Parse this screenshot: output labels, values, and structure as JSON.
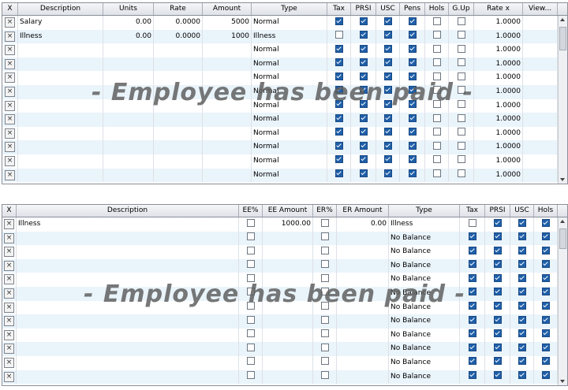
{
  "grid1": {
    "columns": [
      "X",
      "Description",
      "Units",
      "Rate",
      "Amount",
      "Type",
      "Tax",
      "PRSI",
      "USC",
      "Pens",
      "Hols",
      "G.Up",
      "Rate x",
      "View..."
    ],
    "watermark": "- Employee has been paid -",
    "rows": [
      {
        "desc": "Salary",
        "units": "0.00",
        "rate": "0.0000",
        "amount": "5000",
        "type": "Normal",
        "tax": true,
        "prsi": true,
        "usc": true,
        "pens": true,
        "hols": false,
        "gup": false,
        "ratex": "1.0000"
      },
      {
        "desc": "Illness",
        "units": "0.00",
        "rate": "0.0000",
        "amount": "1000",
        "type": "Illness",
        "tax": false,
        "prsi": true,
        "usc": true,
        "pens": true,
        "hols": false,
        "gup": false,
        "ratex": "1.0000"
      },
      {
        "desc": "",
        "units": "",
        "rate": "",
        "amount": "",
        "type": "Normal",
        "tax": true,
        "prsi": true,
        "usc": true,
        "pens": true,
        "hols": false,
        "gup": false,
        "ratex": "1.0000"
      },
      {
        "desc": "",
        "units": "",
        "rate": "",
        "amount": "",
        "type": "Normal",
        "tax": true,
        "prsi": true,
        "usc": true,
        "pens": true,
        "hols": false,
        "gup": false,
        "ratex": "1.0000"
      },
      {
        "desc": "",
        "units": "",
        "rate": "",
        "amount": "",
        "type": "Normal",
        "tax": true,
        "prsi": true,
        "usc": true,
        "pens": true,
        "hols": false,
        "gup": false,
        "ratex": "1.0000"
      },
      {
        "desc": "",
        "units": "",
        "rate": "",
        "amount": "",
        "type": "Normal",
        "tax": true,
        "prsi": true,
        "usc": true,
        "pens": true,
        "hols": false,
        "gup": false,
        "ratex": "1.0000"
      },
      {
        "desc": "",
        "units": "",
        "rate": "",
        "amount": "",
        "type": "Normal",
        "tax": true,
        "prsi": true,
        "usc": true,
        "pens": true,
        "hols": false,
        "gup": false,
        "ratex": "1.0000"
      },
      {
        "desc": "",
        "units": "",
        "rate": "",
        "amount": "",
        "type": "Normal",
        "tax": true,
        "prsi": true,
        "usc": true,
        "pens": true,
        "hols": false,
        "gup": false,
        "ratex": "1.0000"
      },
      {
        "desc": "",
        "units": "",
        "rate": "",
        "amount": "",
        "type": "Normal",
        "tax": true,
        "prsi": true,
        "usc": true,
        "pens": true,
        "hols": false,
        "gup": false,
        "ratex": "1.0000"
      },
      {
        "desc": "",
        "units": "",
        "rate": "",
        "amount": "",
        "type": "Normal",
        "tax": true,
        "prsi": true,
        "usc": true,
        "pens": true,
        "hols": false,
        "gup": false,
        "ratex": "1.0000"
      },
      {
        "desc": "",
        "units": "",
        "rate": "",
        "amount": "",
        "type": "Normal",
        "tax": true,
        "prsi": true,
        "usc": true,
        "pens": true,
        "hols": false,
        "gup": false,
        "ratex": "1.0000"
      },
      {
        "desc": "",
        "units": "",
        "rate": "",
        "amount": "",
        "type": "Normal",
        "tax": true,
        "prsi": true,
        "usc": true,
        "pens": true,
        "hols": false,
        "gup": false,
        "ratex": "1.0000"
      }
    ]
  },
  "grid2": {
    "columns": [
      "X",
      "Description",
      "EE%",
      "EE Amount",
      "ER%",
      "ER Amount",
      "Type",
      "Tax",
      "PRSI",
      "USC",
      "Hols"
    ],
    "watermark": "- Employee has been paid -",
    "rows": [
      {
        "desc": "Illness",
        "eepct": false,
        "eeamt": "1000.00",
        "erpct": false,
        "eramt": "0.00",
        "type": "Illness",
        "tax": false,
        "prsi": true,
        "usc": true,
        "hols": true
      },
      {
        "desc": "",
        "eepct": false,
        "eeamt": "",
        "erpct": false,
        "eramt": "",
        "type": "No Balance",
        "tax": true,
        "prsi": true,
        "usc": true,
        "hols": true
      },
      {
        "desc": "",
        "eepct": false,
        "eeamt": "",
        "erpct": false,
        "eramt": "",
        "type": "No Balance",
        "tax": true,
        "prsi": true,
        "usc": true,
        "hols": true
      },
      {
        "desc": "",
        "eepct": false,
        "eeamt": "",
        "erpct": false,
        "eramt": "",
        "type": "No Balance",
        "tax": true,
        "prsi": true,
        "usc": true,
        "hols": true
      },
      {
        "desc": "",
        "eepct": false,
        "eeamt": "",
        "erpct": false,
        "eramt": "",
        "type": "No Balance",
        "tax": true,
        "prsi": true,
        "usc": true,
        "hols": true
      },
      {
        "desc": "",
        "eepct": false,
        "eeamt": "",
        "erpct": false,
        "eramt": "",
        "type": "No Balance",
        "tax": true,
        "prsi": true,
        "usc": true,
        "hols": true
      },
      {
        "desc": "",
        "eepct": false,
        "eeamt": "",
        "erpct": false,
        "eramt": "",
        "type": "No Balance",
        "tax": true,
        "prsi": true,
        "usc": true,
        "hols": true
      },
      {
        "desc": "",
        "eepct": false,
        "eeamt": "",
        "erpct": false,
        "eramt": "",
        "type": "No Balance",
        "tax": true,
        "prsi": true,
        "usc": true,
        "hols": true
      },
      {
        "desc": "",
        "eepct": false,
        "eeamt": "",
        "erpct": false,
        "eramt": "",
        "type": "No Balance",
        "tax": true,
        "prsi": true,
        "usc": true,
        "hols": true
      },
      {
        "desc": "",
        "eepct": false,
        "eeamt": "",
        "erpct": false,
        "eramt": "",
        "type": "No Balance",
        "tax": true,
        "prsi": true,
        "usc": true,
        "hols": true
      },
      {
        "desc": "",
        "eepct": false,
        "eeamt": "",
        "erpct": false,
        "eramt": "",
        "type": "No Balance",
        "tax": true,
        "prsi": true,
        "usc": true,
        "hols": true
      },
      {
        "desc": "",
        "eepct": false,
        "eeamt": "",
        "erpct": false,
        "eramt": "",
        "type": "No Balance",
        "tax": true,
        "prsi": true,
        "usc": true,
        "hols": true
      }
    ]
  },
  "icons": {
    "delete_row": "close-icon",
    "checkbox": "checkbox-icon"
  },
  "colors": {
    "checked": "#1f5fa8",
    "row_alt": "#eaf4fb",
    "watermark": "#5f5f5f"
  }
}
